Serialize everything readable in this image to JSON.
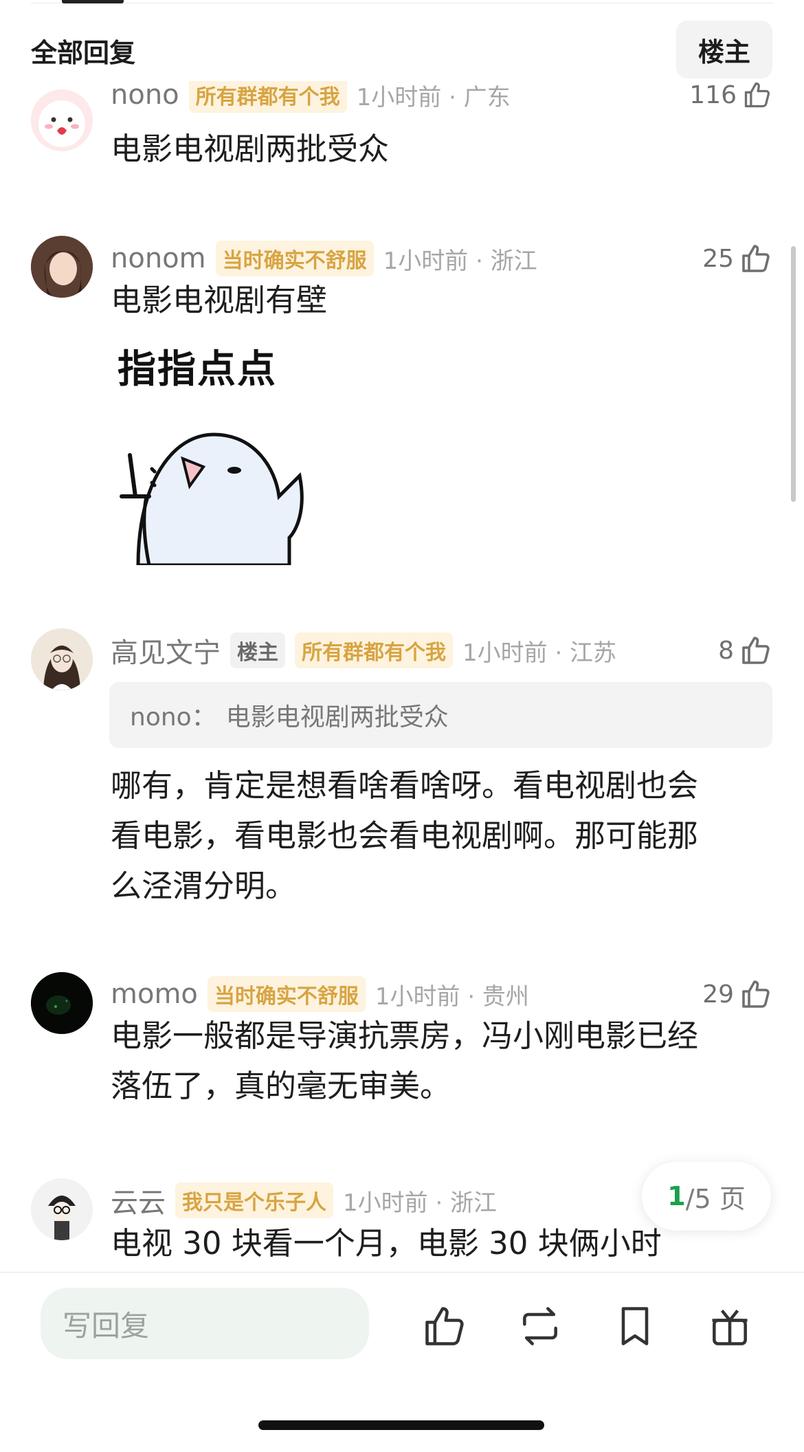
{
  "header": {
    "title": "全部回复",
    "op_button": "楼主"
  },
  "comments": [
    {
      "user": "nono",
      "badges": [
        "所有群都有个我"
      ],
      "meta": "1小时前 · 广东",
      "likes": "116",
      "text": "电影电视剧两批受众"
    },
    {
      "user": "nonom",
      "badges": [
        "当时确实不舒服"
      ],
      "meta": "1小时前 · 浙江",
      "likes": "25",
      "text": "电影电视剧有壁",
      "sticker_text": "指指点点"
    },
    {
      "user": "高见文宁",
      "op_badge": "楼主",
      "badges": [
        "所有群都有个我"
      ],
      "meta": "1小时前 · 江苏",
      "likes": "8",
      "quote_user": "nono：",
      "quote_text": "电影电视剧两批受众",
      "lines": [
        "哪有，肯定是想看啥看啥呀。看电视剧也会",
        "看电影，看电影也会看电视剧啊。那可能那",
        "么泾渭分明。"
      ]
    },
    {
      "user": "momo",
      "badges": [
        "当时确实不舒服"
      ],
      "meta": "1小时前 · 贵州",
      "likes": "29",
      "lines": [
        "电影一般都是导演抗票房，冯小刚电影已经",
        "落伍了，真的毫无审美。"
      ]
    },
    {
      "user": "云云",
      "badges": [
        "我只是个乐子人"
      ],
      "meta": "1小时前 · 浙江",
      "text": "电视 30 块看一个月，电影 30 块俩小时"
    }
  ],
  "pager": {
    "current": "1",
    "total": "/5 页"
  },
  "bottom": {
    "reply_placeholder": "写回复"
  },
  "colors": {
    "accent_green": "#1aa14a",
    "badge_gold": "#d8a443"
  },
  "icons": [
    "thumb-up-icon",
    "repost-icon",
    "bookmark-icon",
    "gift-icon"
  ]
}
